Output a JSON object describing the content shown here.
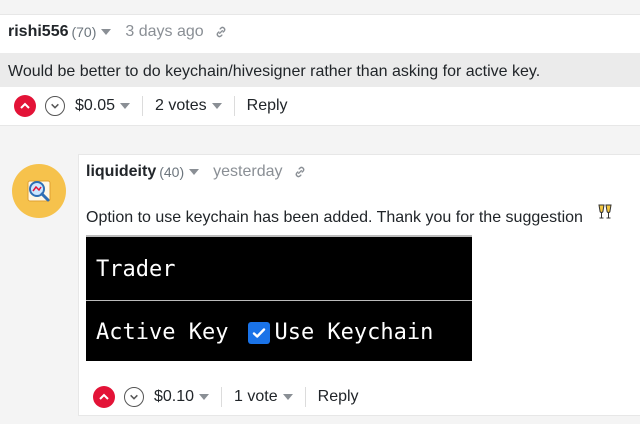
{
  "comment1": {
    "author": "rishi556",
    "reputation": "(70)",
    "time": "3 days ago",
    "body": "Would be better to do keychain/hivesigner rather than asking for active key.",
    "payout": "$0.05",
    "votes": "2 votes",
    "reply_label": "Reply"
  },
  "comment2": {
    "author": "liquideity",
    "reputation": "(40)",
    "time": "yesterday",
    "body": "Option to use keychain has been added. Thank you for the suggestion",
    "embed": {
      "heading": "Trader",
      "field_label": "Active Key",
      "checkbox_label": "Use Keychain",
      "checkbox_checked": true
    },
    "payout": "$0.10",
    "votes": "1 vote",
    "reply_label": "Reply"
  },
  "colors": {
    "upvote": "#e31337",
    "avatar_bg": "#f6c24c",
    "checkbox": "#1a73e8"
  }
}
